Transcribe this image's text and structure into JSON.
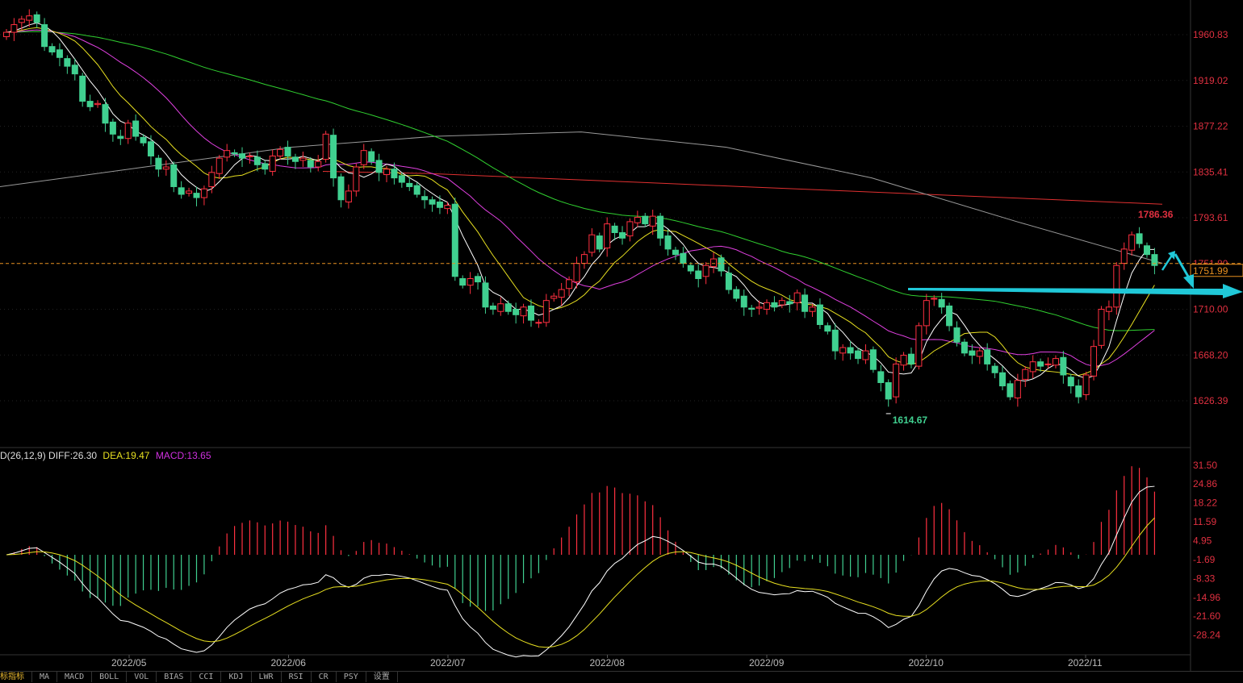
{
  "chart_data": {
    "type": "candlestick",
    "price_axis": {
      "ticks": [
        "1960.83",
        "1919.02",
        "1877.22",
        "1835.41",
        "1793.61",
        "1751.80",
        "1710.00",
        "1668.20",
        "1626.39"
      ],
      "range": [
        1598,
        1985
      ]
    },
    "macd_axis": {
      "ticks": [
        "31.50",
        "24.86",
        "18.22",
        "11.59",
        "4.95",
        "-1.69",
        "-8.33",
        "-14.96",
        "-21.60",
        "-28.24"
      ],
      "range": [
        -34,
        35
      ]
    },
    "months": [
      "2022/05",
      "2022/06",
      "2022/07",
      "2022/08",
      "2022/09",
      "2022/10",
      "2022/11"
    ],
    "closes": [
      1963,
      1970,
      1975,
      1978,
      1972,
      1950,
      1945,
      1940,
      1932,
      1925,
      1900,
      1895,
      1898,
      1880,
      1870,
      1866,
      1880,
      1868,
      1862,
      1850,
      1838,
      1840,
      1822,
      1815,
      1818,
      1812,
      1820,
      1835,
      1848,
      1855,
      1852,
      1848,
      1850,
      1842,
      1838,
      1850,
      1856,
      1850,
      1845,
      1848,
      1840,
      1845,
      1870,
      1830,
      1810,
      1818,
      1840,
      1855,
      1845,
      1835,
      1838,
      1830,
      1826,
      1822,
      1815,
      1810,
      1806,
      1803,
      1805,
      1740,
      1732,
      1738,
      1735,
      1712,
      1710,
      1715,
      1708,
      1705,
      1712,
      1700,
      1698,
      1718,
      1722,
      1728,
      1737,
      1752,
      1760,
      1778,
      1765,
      1788,
      1780,
      1775,
      1790,
      1794,
      1788,
      1795,
      1775,
      1765,
      1760,
      1752,
      1745,
      1738,
      1750,
      1756,
      1745,
      1728,
      1720,
      1712,
      1710,
      1712,
      1716,
      1712,
      1718,
      1715,
      1725,
      1708,
      1712,
      1696,
      1690,
      1672,
      1675,
      1670,
      1665,
      1672,
      1655,
      1643,
      1628,
      1660,
      1668,
      1660,
      1695,
      1718,
      1720,
      1712,
      1695,
      1680,
      1670,
      1668,
      1672,
      1660,
      1652,
      1640,
      1630,
      1645,
      1655,
      1662,
      1658,
      1660,
      1665,
      1650,
      1640,
      1630,
      1650,
      1676,
      1710,
      1712,
      1750,
      1765,
      1778,
      1770,
      1760,
      1750
    ],
    "long_ma_series": [
      {
        "color": "#e03030",
        "values": [
          1836,
          1834,
          1830,
          1826,
          1822,
          1818,
          1814,
          1810,
          1806
        ]
      },
      {
        "color": "#999999",
        "values": [
          1822,
          1840,
          1858,
          1868,
          1872,
          1858,
          1830,
          1790,
          1752
        ]
      }
    ],
    "ma_colors": {
      "ma5": "#ffffff",
      "ma10": "#e8e020",
      "ma20": "#e040e0",
      "ma60": "#30d030"
    },
    "annotations": {
      "high_label": "1786.36",
      "high_value": 1786.36,
      "low_label": "1614.67",
      "low_value": 1614.67,
      "current_line": 1751.8,
      "current_box": "1751.99"
    },
    "colors": {
      "up": "#ff3040",
      "down": "#40d090",
      "axis_text": "#e03040",
      "arrow": "#20c8d8",
      "current": "#e89020"
    }
  },
  "macd_legend": {
    "name": "D(26,12,9)",
    "diff": "DIFF:26.30",
    "dea": "DEA:19.47",
    "macd": "MACD:13.65"
  },
  "tabs": [
    "标指标",
    "MA",
    "MACD",
    "BOLL",
    "VOL",
    "BIAS",
    "CCI",
    "KDJ",
    "LWR",
    "RSI",
    "CR",
    "PSY",
    "设置"
  ]
}
